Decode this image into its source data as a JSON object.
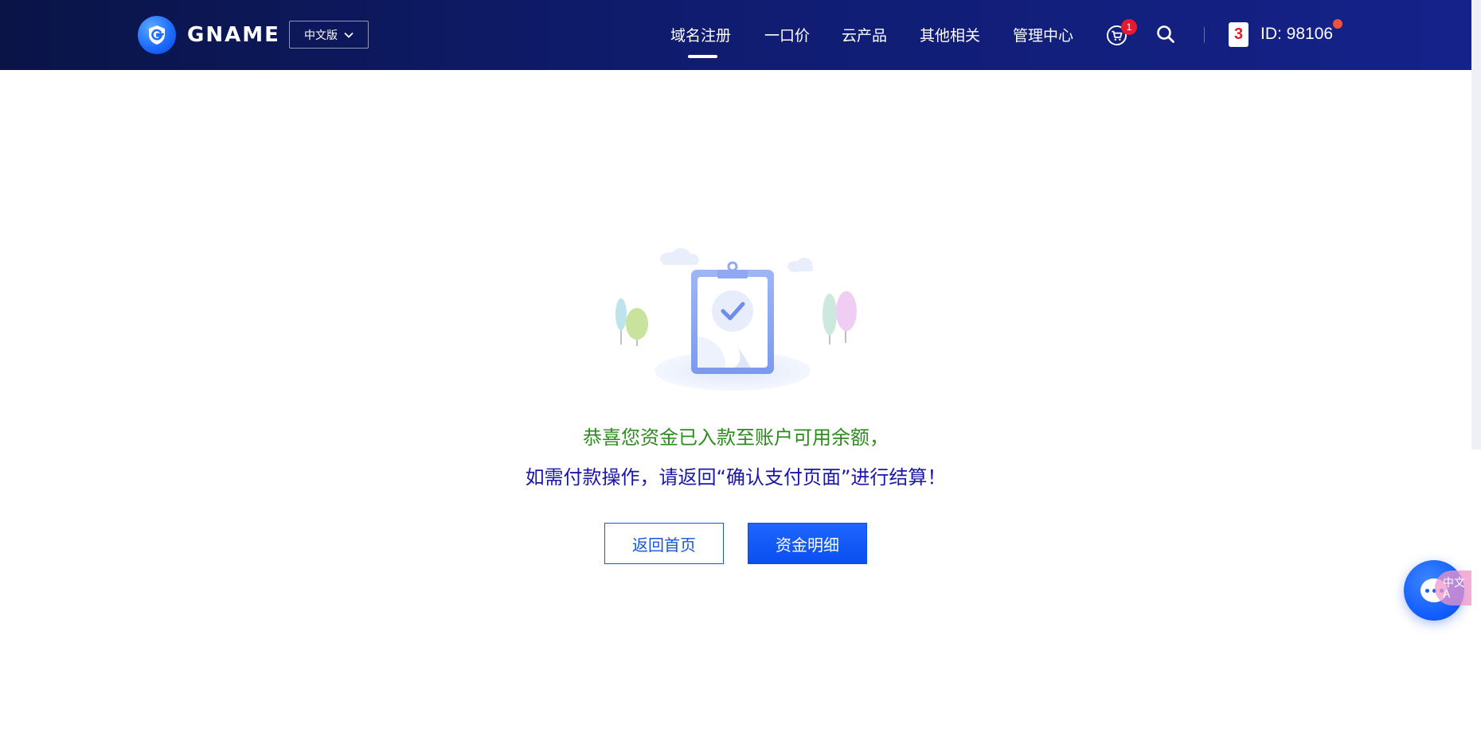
{
  "header": {
    "brand": "GNAME",
    "language": "中文版",
    "nav": [
      "域名注册",
      "一口价",
      "云产品",
      "其他相关",
      "管理中心"
    ],
    "active_nav_index": 0,
    "cart_count": "1",
    "user_card_digit": "3",
    "user_id": "ID: 98106",
    "icons": {
      "logo": "g-shield-logo-icon",
      "dropdown": "chevron-down-icon",
      "cart": "cart-icon",
      "search": "search-icon",
      "notification_dot": "red-dot-indicator"
    }
  },
  "main": {
    "illustration": "clipboard-success-illustration",
    "line1": "恭喜您资金已入款至账户可用余额，",
    "line2": "如需付款操作，请返回“确认支付页面”进行结算！",
    "buttons": {
      "home": "返回首页",
      "funds": "资金明细"
    }
  },
  "floating": {
    "chat_icon": "chat-bubble-icon",
    "tag_text": "中文A"
  },
  "colors": {
    "header_dark": "#0a1447",
    "header_light": "#15228a",
    "success_text": "#2e8b1f",
    "info_text": "#1a16a8",
    "primary": "#0a4ef0",
    "badge": "#e8192c"
  }
}
